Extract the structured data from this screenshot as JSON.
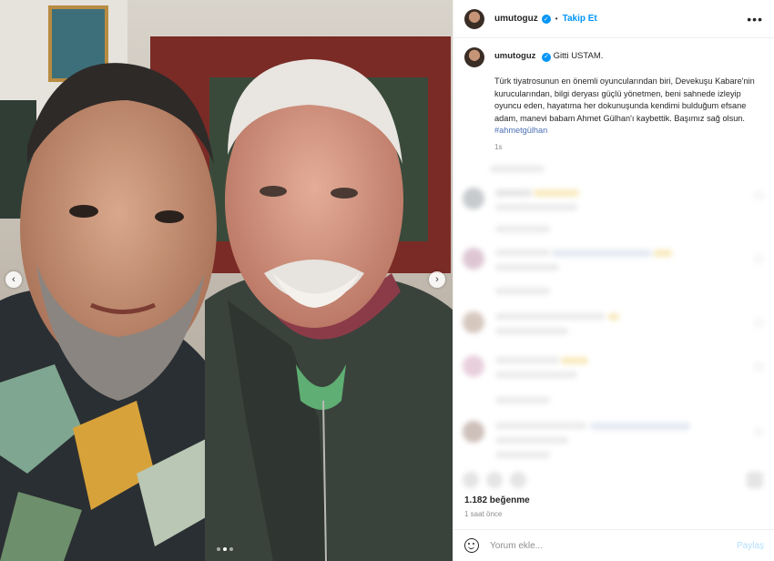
{
  "post": {
    "username": "umutoguz",
    "separator": "•",
    "follow_label": "Takip Et",
    "more_label": "•••",
    "verified_glyph": "✓"
  },
  "caption": {
    "username": "umutoguz",
    "title": "Gitti USTAM.",
    "text": "Türk tiyatrosunun en önemli oyuncularından biri, Devekuşu Kabare'nin kurucularından, bilgi deryası güçlü yönetmen, beni sahnede izleyip oyuncu eden, hayatıma her dokunuşunda kendimi bulduğum efsane adam, manevi babam Ahmet Gülhan'ı kaybettik. Başımız sağ olsun.",
    "hashtag": "#ahmetgülhan",
    "time": "1s"
  },
  "stats": {
    "likes": "1.182 beğenme",
    "posted": "1 saat önce"
  },
  "comment_box": {
    "placeholder": "Yorum ekle...",
    "post_label": "Paylaş"
  },
  "carousel": {
    "prev_glyph": "‹",
    "next_glyph": "›",
    "slide_count": 3,
    "active_slide": 2
  },
  "colors": {
    "accent": "#0095f6",
    "muted": "#8e8e8e"
  }
}
